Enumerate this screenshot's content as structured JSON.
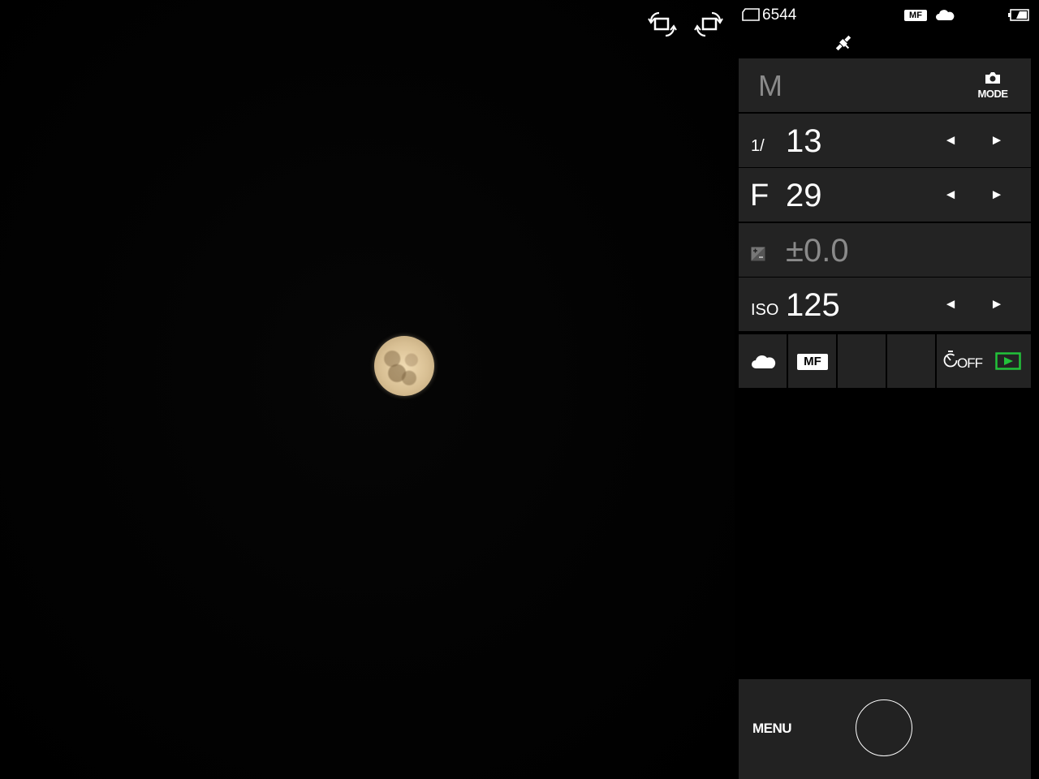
{
  "status": {
    "shots_remaining": "6544",
    "focus_badge": "MF",
    "icons": [
      "memory-card-icon",
      "cloud-icon",
      "battery-icon",
      "gps-satellite-icon"
    ]
  },
  "viewfinder": {
    "icons": [
      "rotate-left-icon",
      "rotate-right-icon"
    ]
  },
  "exposure": {
    "mode": "M",
    "mode_button": "MODE",
    "shutter_prefix": "1/",
    "shutter_value": "13",
    "aperture_prefix": "F",
    "aperture_value": "29",
    "ev_value": "±0.0",
    "iso_prefix": "ISO",
    "iso_value": "125",
    "arrow_left": "◄",
    "arrow_right": "►"
  },
  "tiles": {
    "mf_label": "MF",
    "timer_label": "OFF"
  },
  "bottom": {
    "menu_label": "MENU"
  },
  "colors": {
    "accent_green": "#22c23a",
    "panel": "#232323",
    "disabled_text": "#8a8a8a"
  }
}
